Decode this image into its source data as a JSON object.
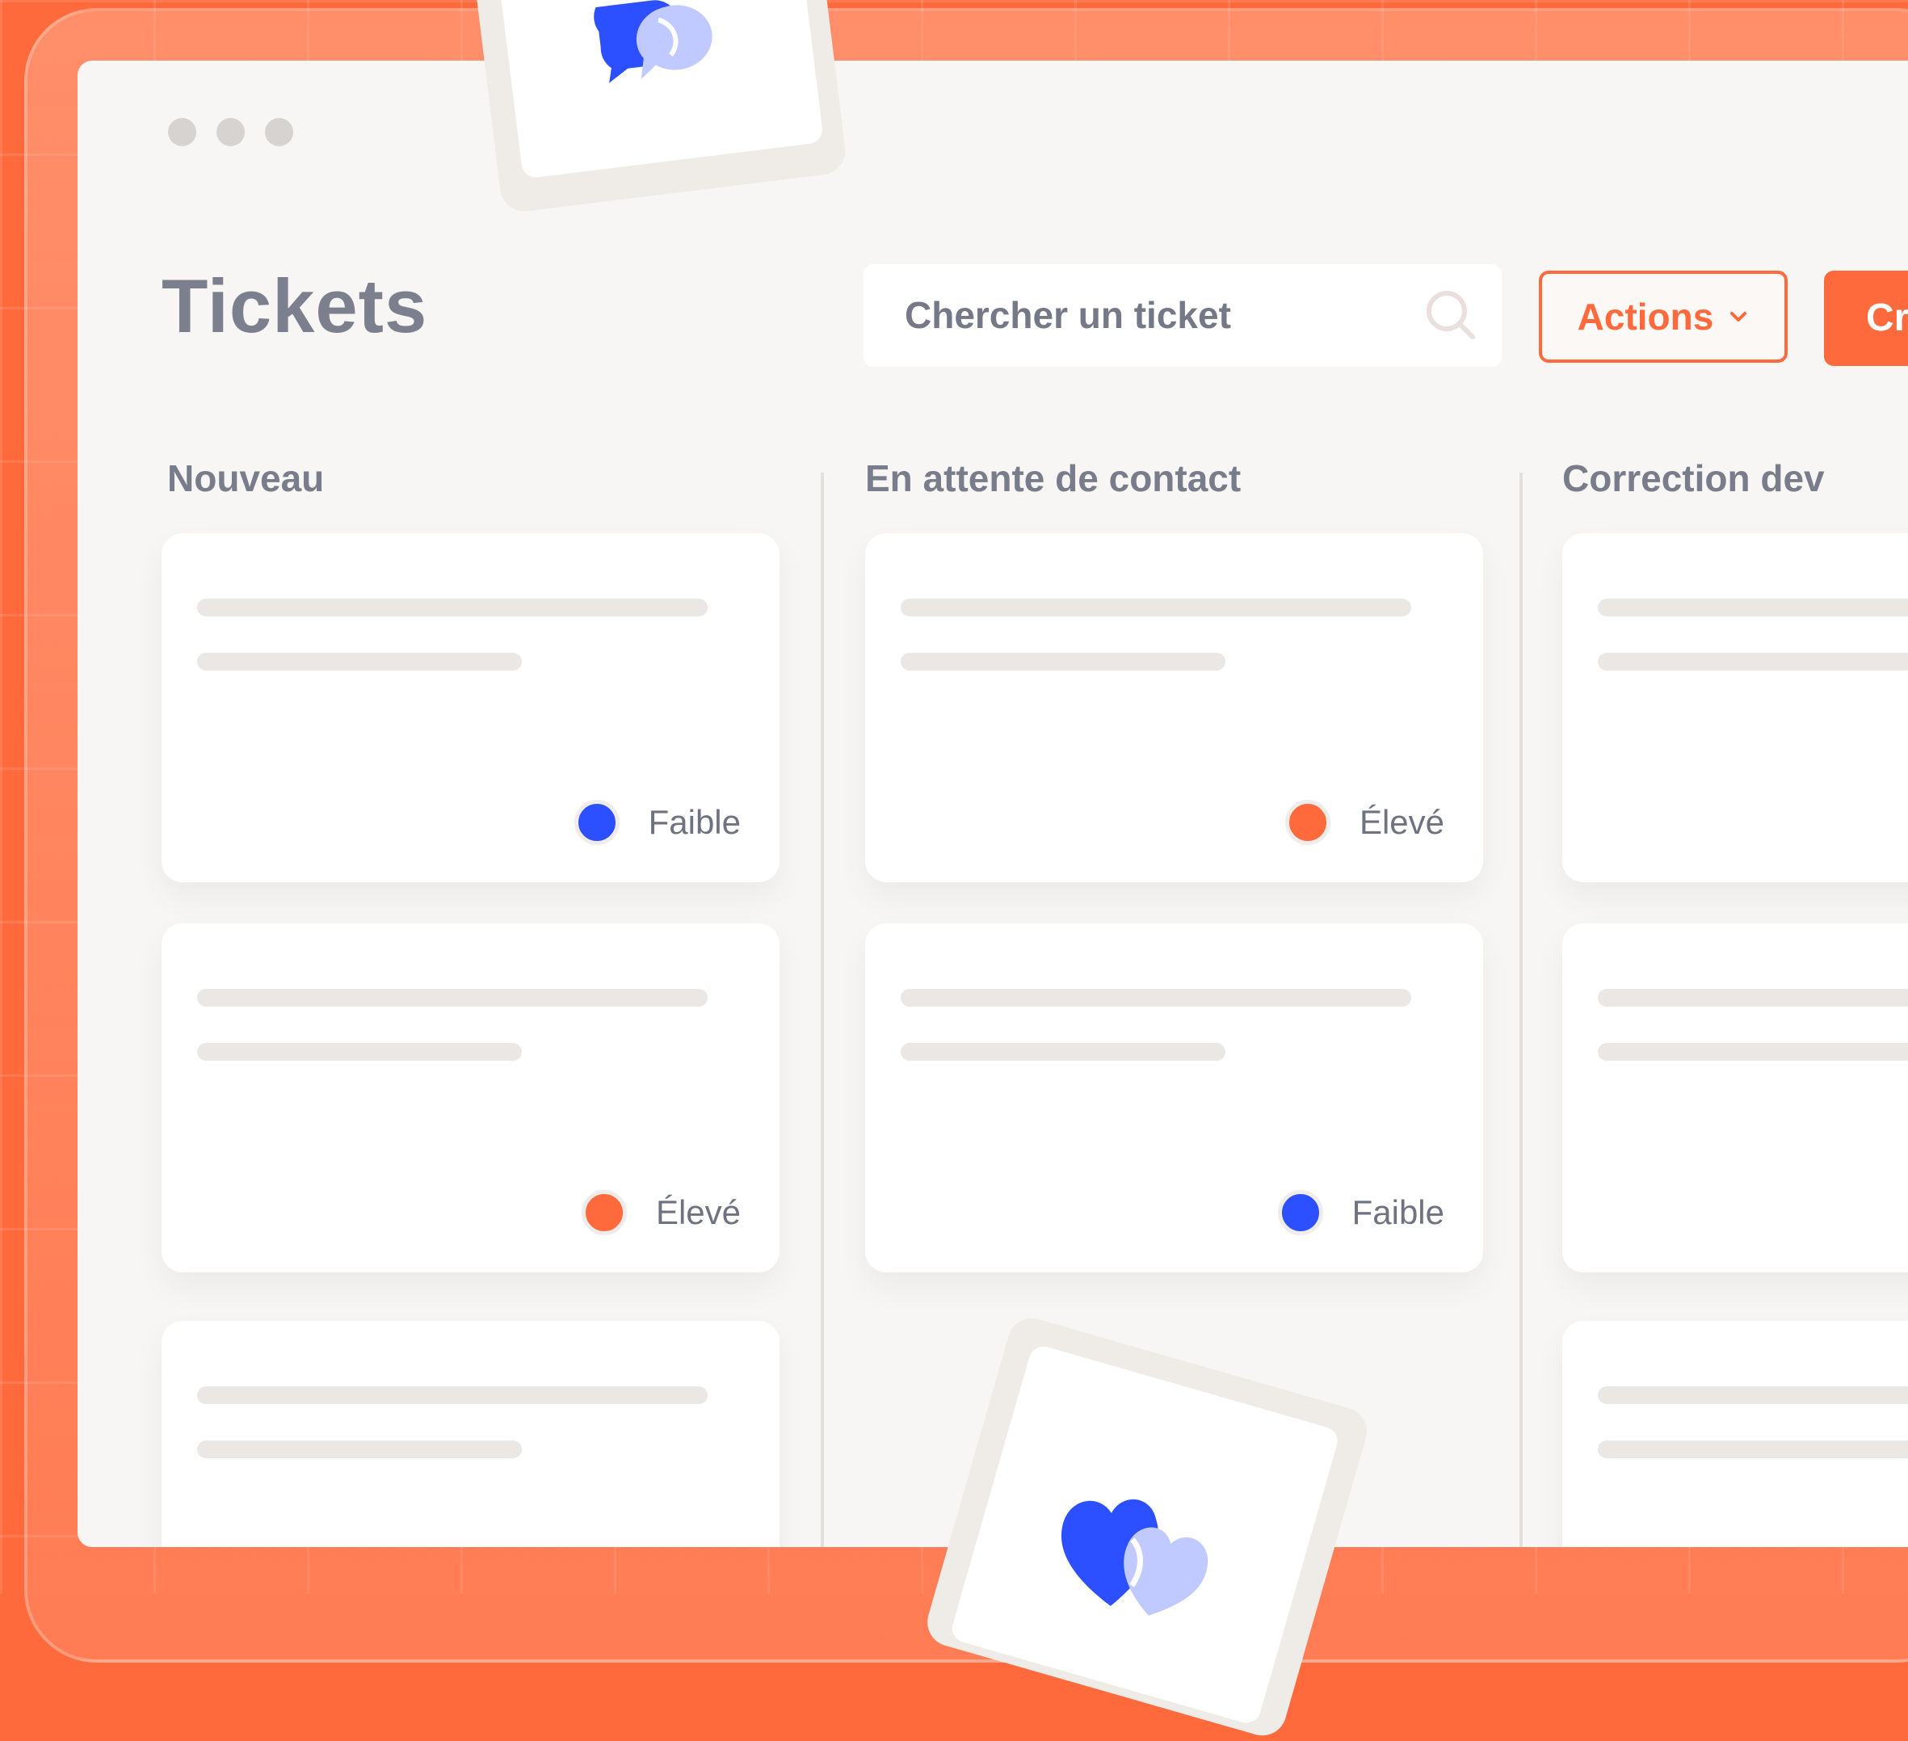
{
  "page": {
    "title": "Tickets"
  },
  "search": {
    "placeholder": "Chercher un ticket"
  },
  "toolbar": {
    "actions_label": "Actions",
    "create_label": "Cr"
  },
  "columns": [
    {
      "title": "Nouveau",
      "cards": [
        {
          "priority": "Faible",
          "priority_color": "#2c4fff"
        },
        {
          "priority": "Élevé",
          "priority_color": "#ff6a3d"
        },
        {
          "priority": "",
          "priority_color": ""
        }
      ]
    },
    {
      "title": "En attente de contact",
      "cards": [
        {
          "priority": "Élevé",
          "priority_color": "#ff6a3d"
        },
        {
          "priority": "Faible",
          "priority_color": "#2c4fff"
        }
      ]
    },
    {
      "title": "Correction dev",
      "cards": [
        {
          "priority": ""
        },
        {
          "priority": ""
        },
        {
          "priority": ""
        }
      ]
    }
  ],
  "colors": {
    "accent": "#ff6a3d",
    "priority_low": "#2c4fff",
    "priority_high": "#ff6a3d"
  },
  "icons": {
    "top_badge": "chat-bubbles-icon",
    "bottom_badge": "hearts-icon",
    "search": "search-icon",
    "actions": "chevron-down-icon"
  }
}
